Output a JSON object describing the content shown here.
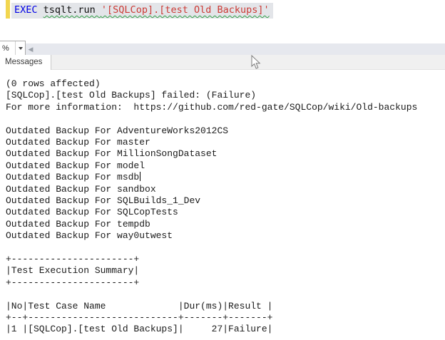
{
  "editor": {
    "tokens": [
      {
        "text": "EXEC ",
        "type": "keyword",
        "squiggle": false
      },
      {
        "text": "tsqlt.run ",
        "type": "plain",
        "squiggle": true
      },
      {
        "text": "'[SQLCop].[test Old Backups]'",
        "type": "string",
        "squiggle": true
      }
    ]
  },
  "editor_bar": {
    "zoom_label": "%",
    "scroll_left_icon": "◀"
  },
  "results": {
    "tab_label": "Messages"
  },
  "messages": {
    "caret_line_index": 8,
    "lines": [
      "(0 rows affected)",
      "[SQLCop].[test Old Backups] failed: (Failure)",
      "For more information:  https://github.com/red-gate/SQLCop/wiki/Old-backups",
      "",
      "Outdated Backup For AdventureWorks2012CS",
      "Outdated Backup For master",
      "Outdated Backup For MillionSongDataset",
      "Outdated Backup For model",
      "Outdated Backup For msdb",
      "Outdated Backup For sandbox",
      "Outdated Backup For SQLBuilds_1_Dev",
      "Outdated Backup For SQLCopTests",
      "Outdated Backup For tempdb",
      "Outdated Backup For way0utwest",
      "",
      "+----------------------+",
      "|Test Execution Summary|",
      "+----------------------+",
      "",
      "|No|Test Case Name             |Dur(ms)|Result |",
      "+--+---------------------------+-------+-------+",
      "|1 |[SQLCop].[test Old Backups]|     27|Failure|"
    ]
  },
  "colors": {
    "keyword": "#0000E6",
    "string": "#CB3A35",
    "squiggle": "#2F9E44",
    "modified_bar": "#F2D64F",
    "selection": "#E3E5E9"
  }
}
